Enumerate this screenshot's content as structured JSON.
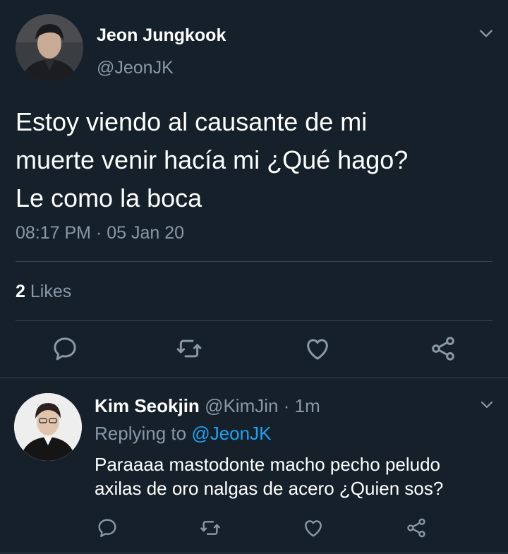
{
  "tweet": {
    "author": {
      "name": "Jeon Jungkook",
      "handle": "@JeonJK",
      "avatar": "avatar-photo-dark"
    },
    "text_lines": [
      "Estoy viendo al causante de mi",
      "muerte venir hacía mi ¿Qué hago?",
      "Le como la boca"
    ],
    "time": "08:17 PM",
    "separator": "·",
    "date": "05 Jan 20",
    "likes": {
      "count": "2",
      "label": "Likes"
    },
    "actions": [
      "reply-icon",
      "retweet-icon",
      "like-icon",
      "share-icon"
    ]
  },
  "reply": {
    "author": {
      "name": "Kim Seokjin",
      "handle": "@KimJin",
      "separator": "·",
      "time": "1m",
      "avatar": "avatar-photo-light"
    },
    "replying_prefix": "Replying to",
    "replying_handle": "@JeonJK",
    "text_lines": [
      "Paraaaa mastodonte macho pecho peludo",
      "axilas de oro nalgas de acero ¿Quien sos?"
    ],
    "actions": [
      "reply-icon",
      "retweet-icon",
      "like-icon",
      "share-icon"
    ]
  },
  "colors": {
    "background": "#15202b",
    "text": "#ffffff",
    "muted": "#8899a6",
    "divider": "#38444d",
    "link": "#1da1f2"
  }
}
